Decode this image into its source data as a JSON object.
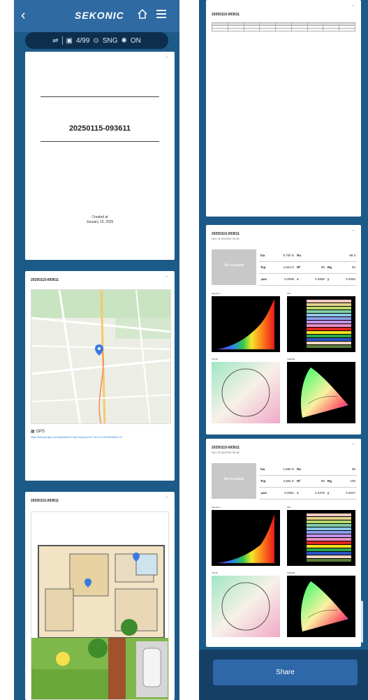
{
  "header": {
    "brand": "SEKONIC",
    "back": "‹"
  },
  "status_bar": {
    "memory": "4/99",
    "mode": "SNG",
    "state": "ON"
  },
  "title_page": {
    "title": "20250115-093611",
    "created_label": "Created at",
    "created_date": "January 15, 2025"
  },
  "map_page": {
    "title": "20250115-093611",
    "gps_label": "GPS",
    "link_text": "https://www.google.com/maps/search/?api=1&query=35.7742172,139.6944548,z=17"
  },
  "floorplan_page": {
    "title": "20250115-093611"
  },
  "report_page": {
    "title": "20250115-093611"
  },
  "measurements": [
    {
      "title": "20250115-093611",
      "sub": "No1   01/15/2025 09:36",
      "thumb": "Not available",
      "lux": "9,700 lx",
      "ra": "99.3",
      "tcp": "2,824 K",
      "rf": "99",
      "rg": "83",
      "duv": "0.0095",
      "x": "0.4956",
      "y": "0.4062",
      "labels": [
        "Spectrum",
        "CRI",
        "TM-30",
        "CIE1931"
      ]
    },
    {
      "title": "20250115-093611",
      "sub": "No1   01/15/2025 09:36",
      "thumb": "Not available",
      "lux": "1,880 lx",
      "ra": "99",
      "tcp": "2,591 K",
      "rf": "99",
      "rg": "100",
      "duv": "0.0081",
      "x": "0.4378",
      "y": "0.4047",
      "labels": [
        "Spectrum",
        "CRI",
        "TM-30",
        "CIE1931"
      ]
    }
  ],
  "table_keys": {
    "lux": "lux",
    "ra": "Ra",
    "tcp": "Tcp",
    "rf": "Rf",
    "rg": "Rg",
    "duv": "⊿uv",
    "x": "x",
    "y": "y"
  },
  "share_label": "Share"
}
